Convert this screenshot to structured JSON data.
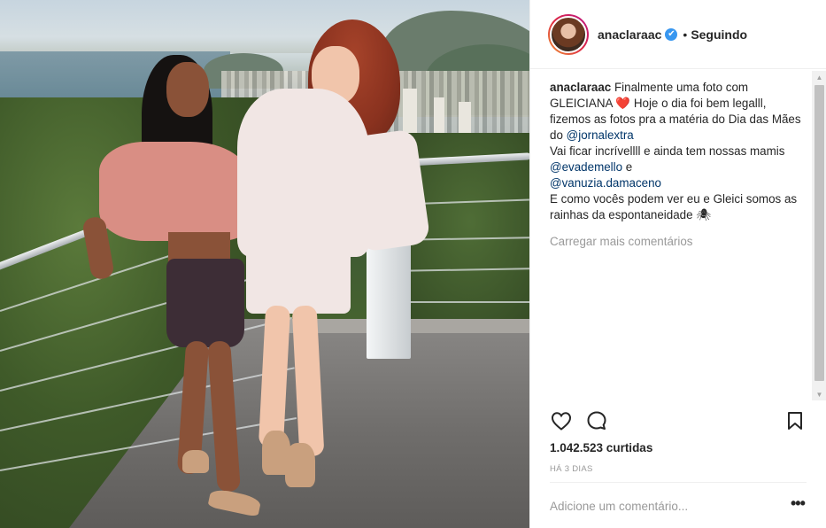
{
  "post": {
    "username": "anaclaraac",
    "verified_icon": "✔",
    "separator": "•",
    "follow_status": "Seguindo",
    "caption": {
      "username": "anaclaraac",
      "part1": "Finalmente uma foto com GLEICIANA ",
      "emoji1": "❤️",
      "part2": " Hoje o dia foi bem legalll, fizemos as fotos pra a matéria do Dia das Mães do ",
      "mention1": "@jornalextra",
      "part3": "Vai ficar incrívellll e ainda tem nossas mamis ",
      "mention2": "@evademello",
      "part4": " e ",
      "mention3": "@vanuzia.damaceno",
      "part5": "E como vocês podem ver eu e Gleici somos as rainhas da espontaneidade ",
      "emoji2": "🕷"
    },
    "load_more": "Carregar mais comentários",
    "likes": "1.042.523 curtidas",
    "time_ago": "HÁ 3 DIAS",
    "comment_placeholder": "Adicione um comentário...",
    "more_options": "•••"
  },
  "icons": {
    "like": "heart-icon",
    "comment": "comment-bubble-icon",
    "save": "bookmark-icon",
    "verified": "verified-badge-icon"
  },
  "colors": {
    "link": "#003569",
    "verified": "#3897f0",
    "muted": "#999999",
    "text": "#262626"
  }
}
